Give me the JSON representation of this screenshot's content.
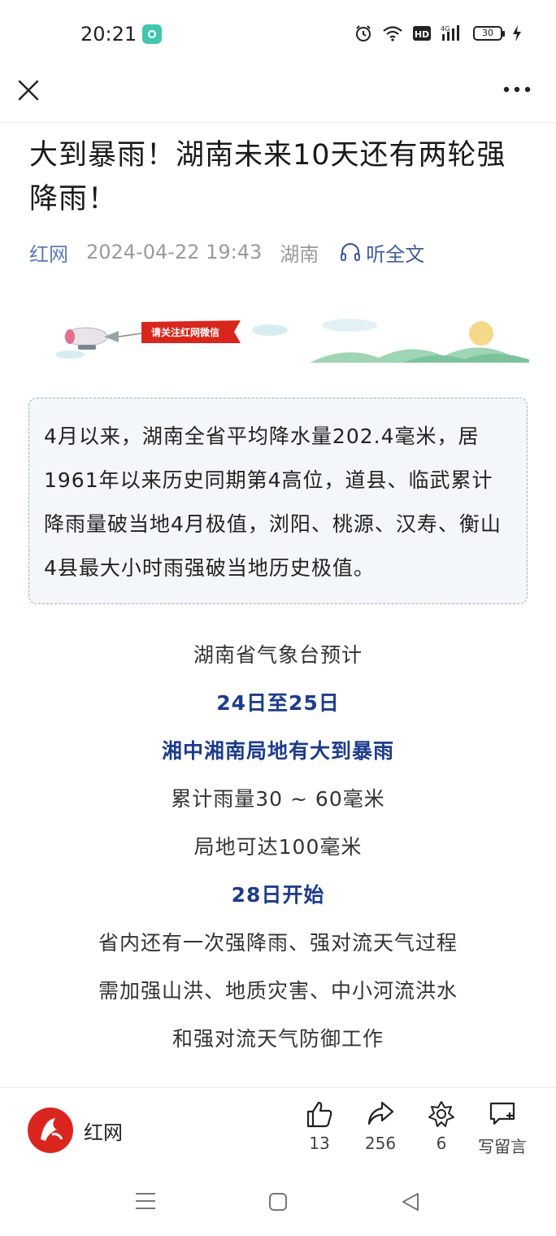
{
  "status_bar": {
    "time": "20:21",
    "network": "4G",
    "hd": "HD",
    "battery": "30"
  },
  "nav": {
    "close_icon": "close-icon",
    "more_icon": "more-icon"
  },
  "article": {
    "title": "大到暴雨！湖南未来10天还有两轮强降雨！",
    "source": "红网",
    "datetime": "2024-04-22 19:43",
    "region": "湖南",
    "listen_label": "听全文"
  },
  "banner": {
    "text": "请关注红网微信"
  },
  "summary": "4月以来，湖南全省平均降水量202.4毫米，居1961年以来历史同期第4高位，道县、临武累计降雨量破当地4月极值，浏阳、桃源、汉寿、衡山4县最大小时雨强破当地历史极值。",
  "forecast": [
    {
      "text": "湖南省气象台预计",
      "emphasis": false
    },
    {
      "text": "24日至25日",
      "emphasis": true
    },
    {
      "text": "湘中湘南局地有大到暴雨",
      "emphasis": true
    },
    {
      "text": "累计雨量30 ~ 60毫米",
      "emphasis": false
    },
    {
      "text": "局地可达100毫米",
      "emphasis": false
    },
    {
      "text": "28日开始",
      "emphasis": true
    },
    {
      "text": "省内还有一次强降雨、强对流天气过程",
      "emphasis": false
    },
    {
      "text": "需加强山洪、地质灾害、中小河流洪水",
      "emphasis": false
    },
    {
      "text": "和强对流天气防御工作",
      "emphasis": false
    }
  ],
  "action_bar": {
    "source_name": "红网",
    "like_count": "13",
    "share_count": "256",
    "collect_count": "6",
    "comment_label": "写留言"
  },
  "colors": {
    "accent_blue": "#1e3c8c",
    "link_blue": "#5a7bb5",
    "brand_red": "#d9251d"
  }
}
